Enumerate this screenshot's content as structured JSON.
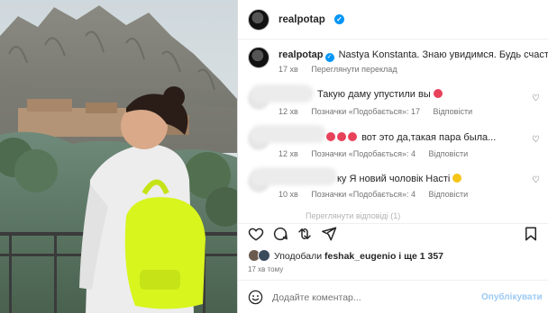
{
  "post": {
    "author": "realpotap",
    "photo_subject": "woman-backpack-mountains"
  },
  "caption": {
    "username": "realpotap",
    "text": "Nastya Konstanta. Знаю увидимся. Будь счастлива",
    "time": "17 хв",
    "translate_label": "Переглянути переклад"
  },
  "comments": [
    {
      "text": "Такую даму упустили вы",
      "emojis": [
        "red"
      ],
      "time": "12 хв",
      "likes": "Позначки «Подобається»: 17",
      "reply": "Відповісти"
    },
    {
      "text": "вот это да,такая пара была...",
      "emojis": [
        "red",
        "red",
        "red"
      ],
      "time": "12 хв",
      "likes": "Позначки «Подобається»: 4",
      "reply": "Відповісти"
    },
    {
      "text": "ку Я новий чоловік Насті",
      "emojis": [
        "yellow"
      ],
      "time": "10 хв",
      "likes": "Позначки «Подобається»: 4",
      "reply": "Відповісти"
    }
  ],
  "more_replies": "Переглянути відповіді (1)",
  "likes": {
    "prefix": "Уподобали",
    "user": "feshak_eugenio",
    "rest": "і ще 1 357"
  },
  "posted_ago": "17 хв тому",
  "composer": {
    "placeholder": "Додайте коментар...",
    "post_label": "Опублікувати"
  },
  "colors": {
    "verified": "#0095f6",
    "backpack": "#d8f51e",
    "post_button": "#9ccaf3"
  },
  "icons": [
    "heart-icon",
    "comment-icon",
    "share-icon",
    "bookmark-icon",
    "emoji-icon",
    "verified-icon"
  ]
}
